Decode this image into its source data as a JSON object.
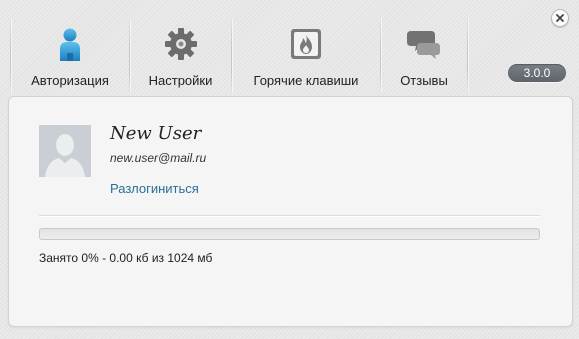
{
  "toolbar": {
    "items": [
      {
        "label": "Авторизация",
        "icon": "user-icon"
      },
      {
        "label": "Настройки",
        "icon": "gear-icon"
      },
      {
        "label": "Горячие клавиши",
        "icon": "flame-icon"
      },
      {
        "label": "Отзывы",
        "icon": "speech-bubbles-icon"
      }
    ],
    "version": "3.0.0",
    "close_icon": "close-icon"
  },
  "profile": {
    "name": "New User",
    "email": "new.user@mail.ru",
    "logout_label": "Разлогиниться",
    "avatar_icon": "default-avatar-icon"
  },
  "storage": {
    "used_percent": 0,
    "summary": "Занято 0% - 0.00 кб из 1024 мб"
  },
  "colors": {
    "link": "#2b6f94",
    "accent_blue": "#2f8fc7",
    "version_badge": "#6a7078"
  }
}
